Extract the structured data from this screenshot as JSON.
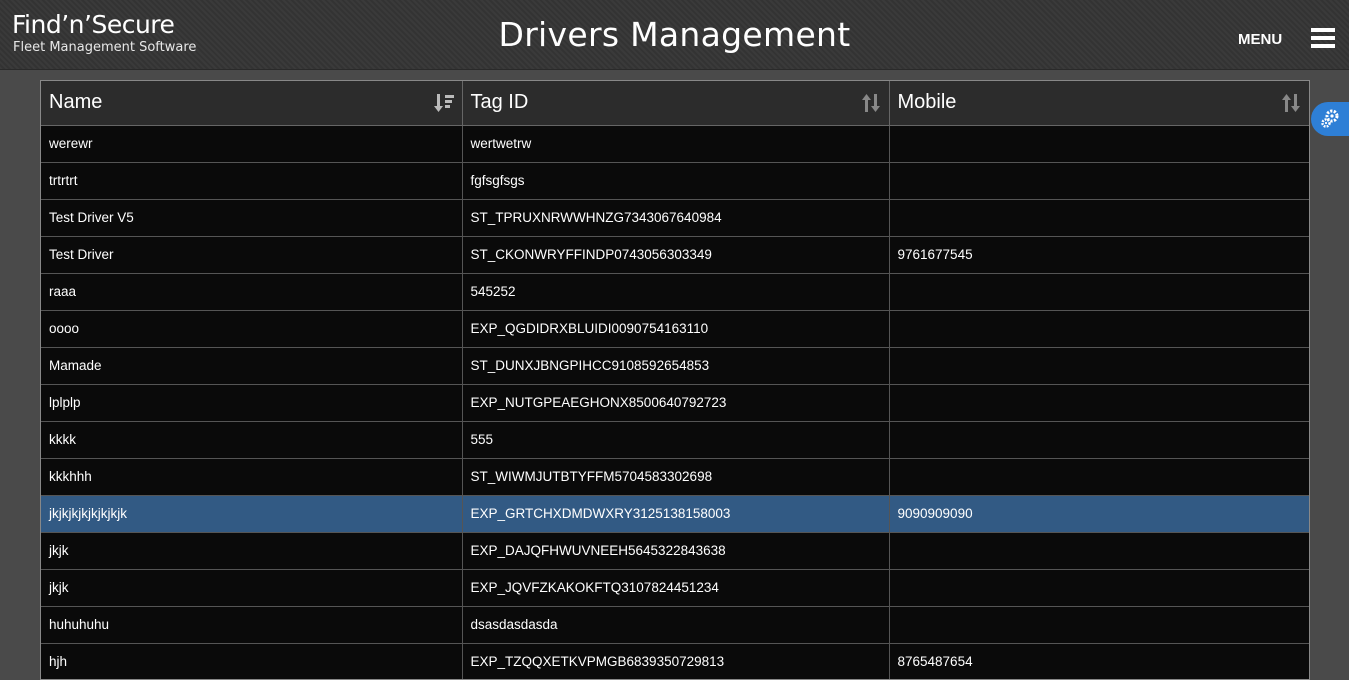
{
  "header": {
    "logo_title": "Find’n’Secure",
    "logo_subtitle": "Fleet Management Software",
    "page_title": "Drivers Management",
    "menu_label": "MENU"
  },
  "icons": {
    "menu": "hamburger-icon",
    "sort_name": "sort-descending-icon",
    "sort_other": "sort-icon",
    "side_tab": "settings-gears-icon"
  },
  "colors": {
    "selected_row": "#325a84",
    "side_tab": "#2e7fd6",
    "table_bg": "#0a0a0a",
    "header_bg": "#2c2c2c"
  },
  "table": {
    "columns": [
      "Name",
      "Tag ID",
      "Mobile"
    ],
    "rows": [
      {
        "name": "werewr",
        "tag_id": "wertwetrw",
        "mobile": ""
      },
      {
        "name": "trtrtrt",
        "tag_id": "fgfsgfsgs",
        "mobile": ""
      },
      {
        "name": "Test Driver V5",
        "tag_id": "ST_TPRUXNRWWHNZG7343067640984",
        "mobile": ""
      },
      {
        "name": "Test Driver",
        "tag_id": "ST_CKONWRYFFINDP0743056303349",
        "mobile": "9761677545"
      },
      {
        "name": "raaa",
        "tag_id": "545252",
        "mobile": ""
      },
      {
        "name": "oooo",
        "tag_id": "EXP_QGDIDRXBLUIDI0090754163110",
        "mobile": ""
      },
      {
        "name": "Mamade",
        "tag_id": "ST_DUNXJBNGPIHCC9108592654853",
        "mobile": ""
      },
      {
        "name": "lplplp",
        "tag_id": "EXP_NUTGPEAEGHONX8500640792723",
        "mobile": ""
      },
      {
        "name": "kkkk",
        "tag_id": "555",
        "mobile": ""
      },
      {
        "name": "kkkhhh",
        "tag_id": "ST_WIWMJUTBTYFFM5704583302698",
        "mobile": ""
      },
      {
        "name": "jkjkjkjkjkjkjkjk",
        "tag_id": "EXP_GRTCHXDMDWXRY3125138158003",
        "mobile": "9090909090"
      },
      {
        "name": "jkjk",
        "tag_id": "EXP_DAJQFHWUVNEEH5645322843638",
        "mobile": ""
      },
      {
        "name": "jkjk",
        "tag_id": "EXP_JQVFZKAKOKFTQ3107824451234",
        "mobile": ""
      },
      {
        "name": "huhuhuhu",
        "tag_id": "dsasdasdasda",
        "mobile": ""
      },
      {
        "name": "hjh",
        "tag_id": "EXP_TZQQXETKVPMGB6839350729813",
        "mobile": "8765487654"
      }
    ],
    "selected_row": 10
  }
}
